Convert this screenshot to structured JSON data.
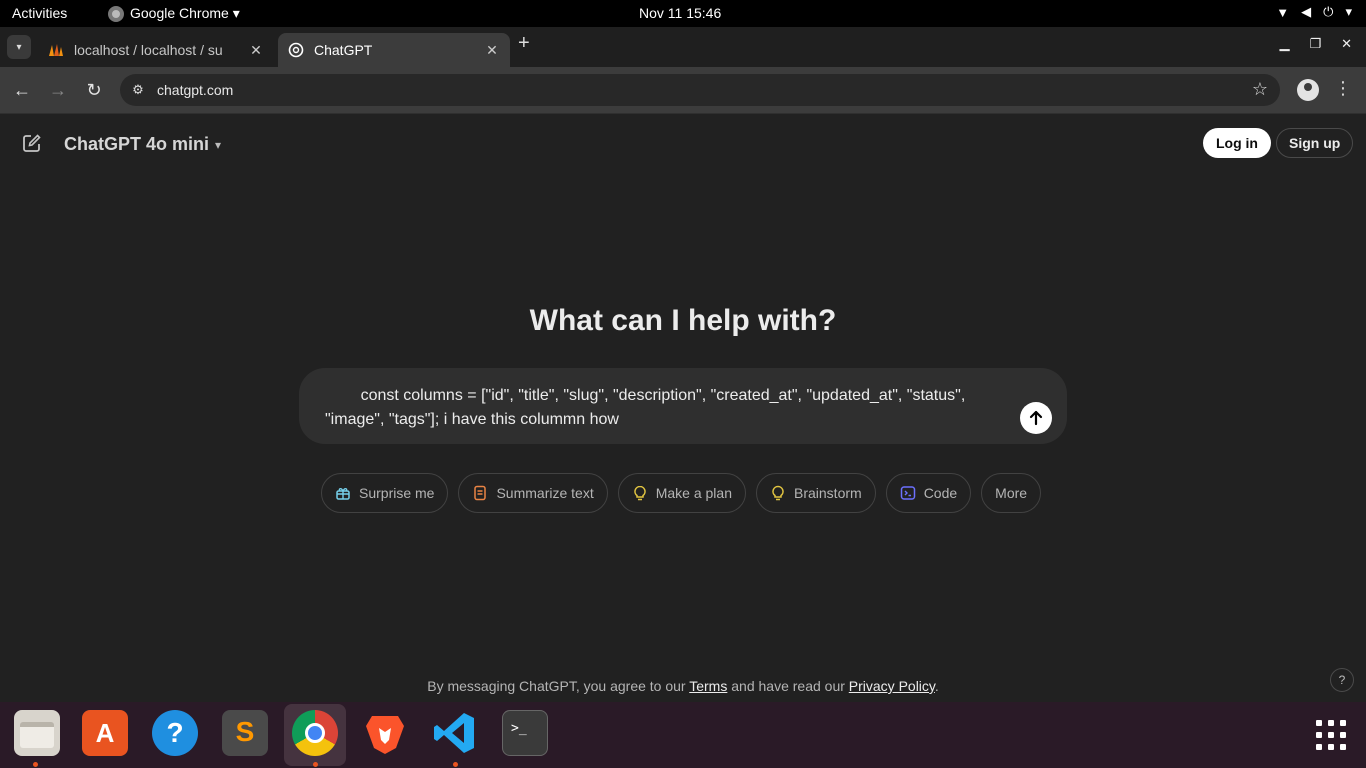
{
  "system": {
    "activities": "Activities",
    "app_name": "Google Chrome ▾",
    "clock": "Nov 11  15:46"
  },
  "browser": {
    "tabs": [
      {
        "label": "localhost / localhost / su",
        "close": "✕"
      },
      {
        "label": "ChatGPT",
        "close": "✕"
      }
    ],
    "new_tab": "+",
    "url": "chatgpt.com"
  },
  "chatgpt": {
    "model": "ChatGPT 4o mini",
    "login": "Log in",
    "signup": "Sign up",
    "heading": "What can I help with?",
    "composer_text": "        const columns = [\"id\", \"title\", \"slug\", \"description\", \"created_at\", \"updated_at\", \"status\", \"image\", \"tags\"]; i have this colummn how",
    "chips": [
      {
        "label": "Surprise me",
        "icon": "gift-icon",
        "color": "#76d0eb"
      },
      {
        "label": "Summarize text",
        "icon": "document-icon",
        "color": "#ea8444"
      },
      {
        "label": "Make a plan",
        "icon": "lightbulb-icon",
        "color": "#e2c541"
      },
      {
        "label": "Brainstorm",
        "icon": "lightbulb-icon",
        "color": "#e2c541"
      },
      {
        "label": "Code",
        "icon": "terminal-icon",
        "color": "#6c71ff"
      },
      {
        "label": "More",
        "icon": "",
        "color": ""
      }
    ],
    "footer": {
      "prefix": "By messaging ChatGPT, you agree to our ",
      "terms": "Terms",
      "middle": " and have read our ",
      "privacy": "Privacy Policy",
      "suffix": "."
    },
    "help": "?"
  },
  "dock": {
    "apps": [
      "files-icon",
      "app-center-icon",
      "help-icon",
      "sublime-text-icon",
      "chrome-icon",
      "brave-icon",
      "vscode-icon",
      "terminal-icon"
    ]
  }
}
